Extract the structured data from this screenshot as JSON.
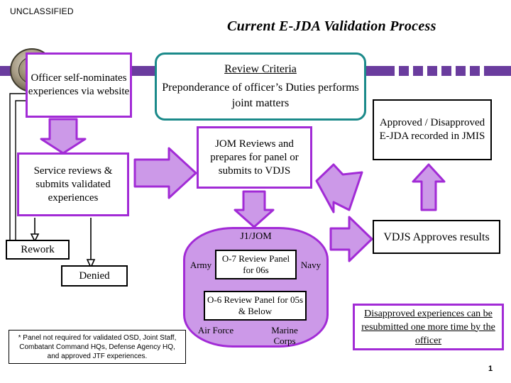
{
  "header": {
    "classification": "UNCLASSIFIED",
    "title": "Current E-JDA Validation Process"
  },
  "colors": {
    "purple_border": "#a22bd6",
    "purple_fill": "#cc99e8",
    "teal_border": "#1b8a8a",
    "bar_purple": "#6a3c9e",
    "black": "#000000",
    "white": "#ffffff"
  },
  "boxes": {
    "officer": "Officer self-nominates experiences via website",
    "review_criteria": {
      "title": "Review Criteria",
      "body": "Preponderance of officer’s Duties performs joint matters"
    },
    "service": "Service reviews & submits validated experiences",
    "jom": "JOM Reviews and prepares for panel or submits to VDJS",
    "approved": "Approved / Disapproved E-JDA recorded in JMIS",
    "vdjs": "VDJS Approves results",
    "rework": "Rework",
    "denied": "Denied",
    "o7_panel": "O-7 Review Panel for 06s",
    "o6_panel": "O-6 Review Panel for 05s & Below",
    "disapproved": "Disapproved experiences can be resubmitted one more time by the officer",
    "footnote": "* Panel not required for validated OSD, Joint Staff, Combatant Command HQs, Defense Agency HQ, and approved JTF experiences."
  },
  "group": {
    "title": "J1/JOM",
    "services": {
      "army": "Army",
      "navy": "Navy",
      "air_force": "Air Force",
      "marine_corps": "Marine Corps"
    }
  },
  "footer": {
    "page_number": "1"
  },
  "icons": {
    "seal": "dod-seal-icon"
  }
}
